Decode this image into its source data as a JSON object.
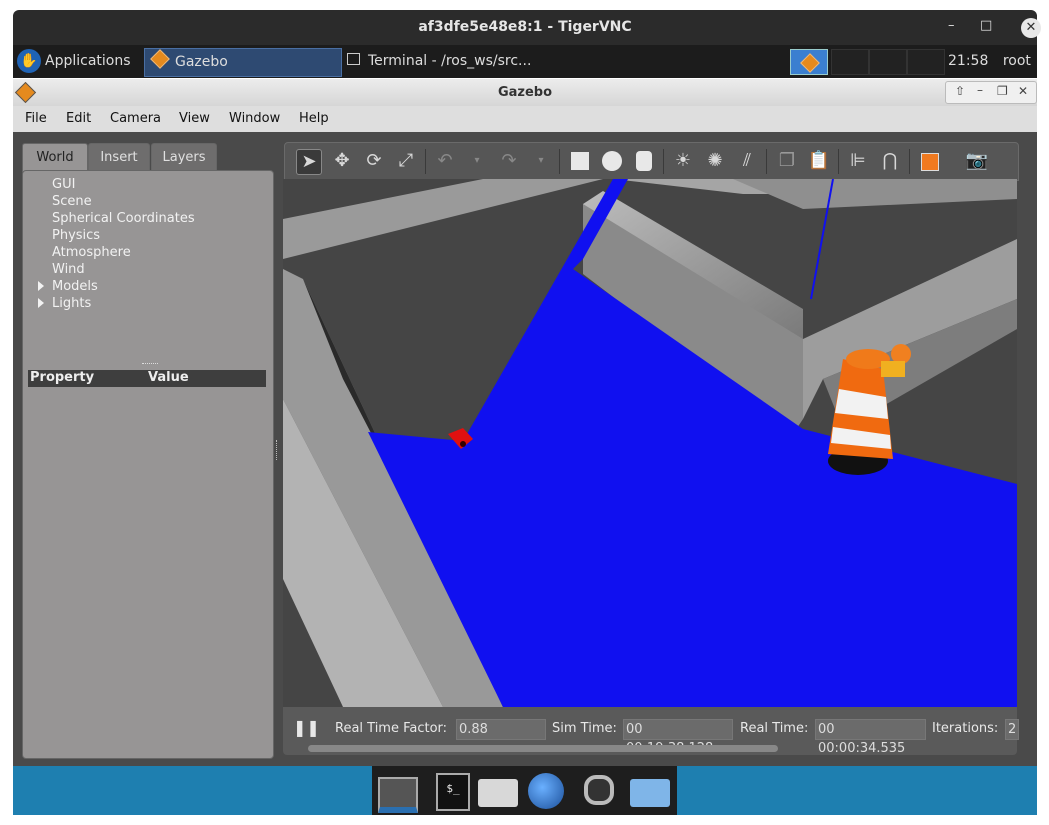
{
  "vnc": {
    "title": "af3dfe5e48e8:1 - TigerVNC",
    "minimize": "–",
    "maximize": "□",
    "close": "✕"
  },
  "panel": {
    "applications_label": "Applications",
    "tasks": [
      {
        "label": "Gazebo",
        "active": true
      },
      {
        "label": "Terminal - /ros_ws/src...",
        "active": false
      }
    ],
    "clock": "21:58",
    "user": "root"
  },
  "gazebo_window": {
    "title": "Gazebo"
  },
  "menu": [
    "File",
    "Edit",
    "Camera",
    "View",
    "Window",
    "Help"
  ],
  "left_tabs": [
    "World",
    "Insert",
    "Layers"
  ],
  "world_tree": [
    "GUI",
    "Scene",
    "Spherical Coordinates",
    "Physics",
    "Atmosphere",
    "Wind",
    "Models",
    "Lights"
  ],
  "property_table": {
    "col1": "Property",
    "col2": "Value"
  },
  "toolbar_icons": [
    "select-arrow-icon",
    "translate-icon",
    "rotate-icon",
    "scale-icon",
    "undo-icon",
    "redo-icon",
    "box-icon",
    "sphere-icon",
    "cylinder-icon",
    "point-light-icon",
    "spot-light-icon",
    "directional-light-icon",
    "copy-icon",
    "paste-icon",
    "align-icon",
    "magnet-icon",
    "view-angle-icon",
    "screenshot-icon"
  ],
  "status": {
    "pause_glyph": "❚❚",
    "rtf_label": "Real Time Factor:",
    "rtf_value": "0.88",
    "sim_label": "Sim Time:",
    "sim_value": "00 00:19:38.128",
    "real_label": "Real Time:",
    "real_value": "00 00:00:34.535",
    "iter_label": "Iterations:",
    "iter_value": "2"
  },
  "dock": [
    "show-desktop-icon",
    "terminal-icon",
    "home-folder-icon",
    "web-browser-icon",
    "search-icon",
    "files-icon"
  ],
  "colors": {
    "scan_blue": "#1010f0",
    "barrel_orange": "#f06a10",
    "robot_red": "#e01010"
  }
}
